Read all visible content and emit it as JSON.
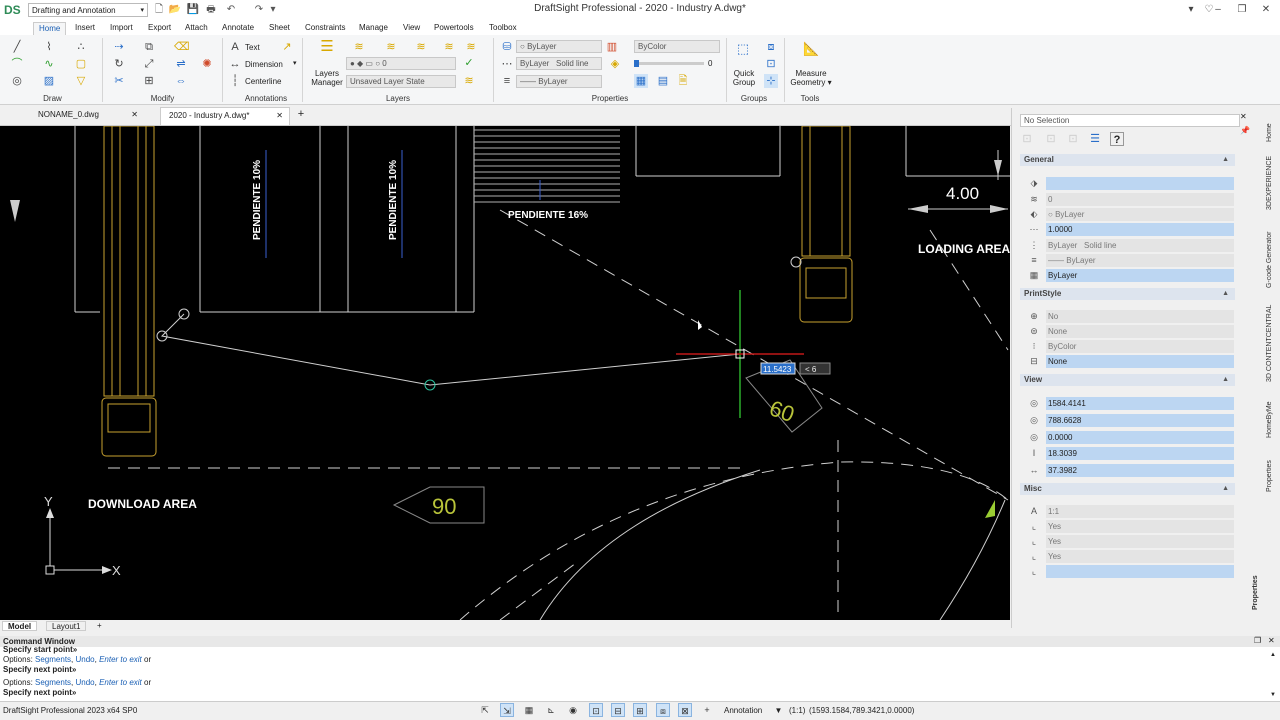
{
  "app": {
    "title": "DraftSight Professional - 2020 - Industry A.dwg*",
    "workspace": "Drafting and Annotation",
    "logo_text": "DS",
    "window_controls": {
      "minimize": "–",
      "restore": "❐",
      "close": "✕"
    }
  },
  "ribbon_tabs": [
    "Home",
    "Insert",
    "Import",
    "Export",
    "Attach",
    "Annotate",
    "Sheet",
    "Constraints",
    "Manage",
    "View",
    "Powertools",
    "Toolbox"
  ],
  "ribbon": {
    "groups": [
      "Draw",
      "Modify",
      "Annotations",
      "Layers",
      "Properties",
      "Groups",
      "Tools"
    ],
    "annotations": {
      "text": "Text",
      "dimension": "Dimension",
      "centerline": "Centerline"
    },
    "layers": {
      "manager_line1": "Layers",
      "manager_line2": "Manager",
      "layer_value": "0",
      "layer_state": "Unsaved Layer State"
    },
    "properties": {
      "color": "ByLayer",
      "color2": "ByColor",
      "linetype": "ByLayer",
      "linestyle": "Solid line",
      "lineweight": "ByLayer",
      "transparency": "0"
    },
    "groups_btn": {
      "line1": "Quick",
      "line2": "Group"
    },
    "tools_btn": {
      "line1": "Measure",
      "line2": "Geometry"
    }
  },
  "doc_tabs": [
    "NONAME_0.dwg",
    "2020 - Industry A.dwg*"
  ],
  "canvas": {
    "labels": {
      "slope1": "PENDIENTE 10%",
      "slope2": "PENDIENTE 10%",
      "slope3": "PENDIENTE 16%",
      "dim": "4.00",
      "loading": "LOADING AREA",
      "download": "DOWNLOAD AREA",
      "arrow90": "90",
      "arrow60": "60",
      "axis_x": "X",
      "axis_y": "Y"
    },
    "input_length": "11.5423",
    "input_angle": "< 6"
  },
  "layout_tabs": [
    "Model",
    "Layout1",
    "+"
  ],
  "properties_panel": {
    "selection": "No Selection",
    "help": "?",
    "general": {
      "title": "General",
      "values": [
        "",
        "0",
        "ByLayer",
        "1.0000",
        "ByLayer",
        "Solid line",
        "ByLayer",
        "ByLayer"
      ]
    },
    "printstyle": {
      "title": "PrintStyle",
      "values": [
        "No",
        "None",
        "ByColor",
        "None"
      ]
    },
    "view": {
      "title": "View",
      "values": [
        "1584.4141",
        "788.6628",
        "0.0000",
        "18.3039",
        "37.3982"
      ]
    },
    "misc": {
      "title": "Misc",
      "values": [
        "1:1",
        "Yes",
        "Yes",
        "Yes",
        ""
      ]
    }
  },
  "side_tabs": [
    "Home",
    "3DEXPERIENCE",
    "G-code Generator",
    "3D CONTENTCENTRAL",
    "HomeByMe",
    "Properties"
  ],
  "side_label": "Properties",
  "command_window": {
    "title": "Command Window",
    "lines": [
      {
        "prefix": "Specify start point»",
        "bold": true
      },
      {
        "prefix": "Options: ",
        "links": [
          "Segments",
          "Undo",
          "Enter to exit"
        ],
        "suffix": " or"
      },
      {
        "prefix": "Specify next point»",
        "bold": true
      },
      {
        "prefix": "Options: ",
        "links": [
          "Segments",
          "Undo",
          "Enter to exit"
        ],
        "suffix": " or"
      },
      {
        "prefix": "Specify next point»",
        "bold": true
      }
    ]
  },
  "status": {
    "app_version": "DraftSight Professional 2023  x64 SP0",
    "annotation": "Annotation",
    "scale": "(1:1)",
    "coords": "(1593.1584,789.3421,0.0000)"
  }
}
